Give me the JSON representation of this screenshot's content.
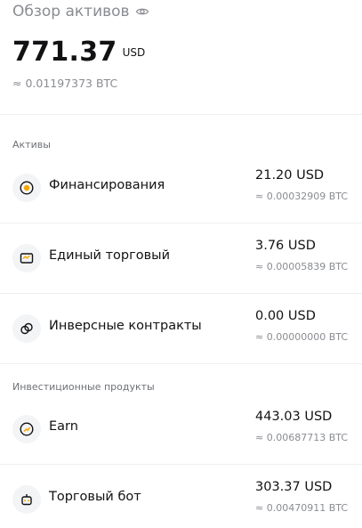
{
  "header": {
    "title": "Обзор активов",
    "total_value": "771.37",
    "total_currency": "USD",
    "total_btc": "≈ 0.01197373 BTC"
  },
  "sections": {
    "assets_label": "Активы",
    "investments_label": "Инвестиционные продукты"
  },
  "rows": [
    {
      "name": "Финансирования",
      "value": "21.20 USD",
      "btc": "≈ 0.00032909 BTC",
      "icon": "coin-icon"
    },
    {
      "name": "Единый торговый",
      "value": "3.76 USD",
      "btc": "≈ 0.00005839 BTC",
      "icon": "wallet-icon"
    },
    {
      "name": "Инверсные контракты",
      "value": "0.00 USD",
      "btc": "≈ 0.00000000 BTC",
      "icon": "link-icon"
    },
    {
      "name": "Earn",
      "value": "443.03 USD",
      "btc": "≈ 0.00687713 BTC",
      "icon": "earn-icon"
    },
    {
      "name": "Торговый бот",
      "value": "303.37 USD",
      "btc": "≈ 0.00470911 BTC",
      "icon": "bot-icon"
    }
  ],
  "colors": {
    "text_primary": "#121214",
    "text_secondary": "#8a8c91",
    "divider": "#eeeff1",
    "icon_bg": "#f3f4f6",
    "accent": "#f7a600"
  }
}
